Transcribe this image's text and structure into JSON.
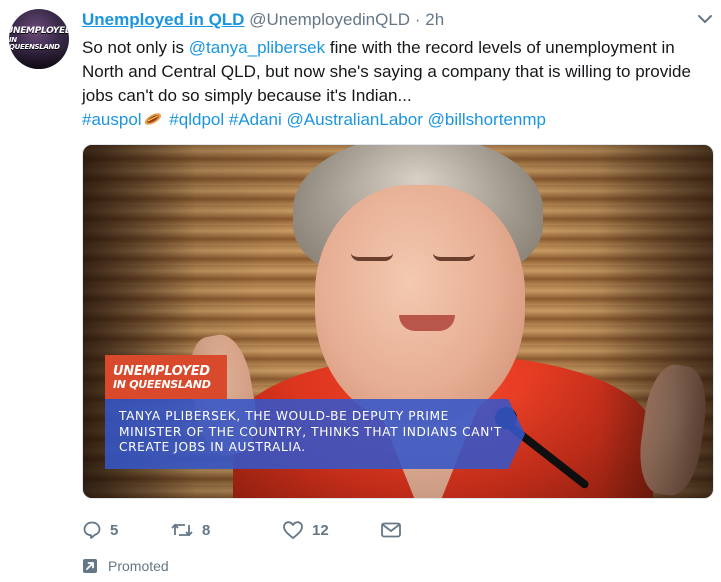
{
  "tweet": {
    "avatar": {
      "line1": "UNEMPLOYED",
      "line2": "IN QUEENSLAND"
    },
    "display_name": "Unemployed in QLD",
    "handle": "@UnemployedinQLD",
    "separator": "·",
    "timestamp": "2h",
    "body": {
      "part1": "So not only is ",
      "mention1": "@tanya_plibersek",
      "part2": " fine with the record levels of unemployment in North and Central QLD, but now she's saying a company that is willing to provide jobs can't do so simply because it's Indian..."
    },
    "hashtags": {
      "h1": "#auspol",
      "h2": "#qldpol",
      "h3": "#Adani",
      "m2": "@AustralianLabor",
      "m3": "@billshortenmp"
    },
    "media": {
      "logo_line1": "UNEMPLOYED",
      "logo_line2": "IN QUEENSLAND",
      "caption": "TANYA PLIBERSEK, THE WOULD-BE DEPUTY PRIME MINISTER OF THE COUNTRY, THINKS THAT INDIANS CAN'T CREATE JOBS IN AUSTRALIA."
    },
    "actions": {
      "reply_count": "5",
      "retweet_count": "8",
      "like_count": "12"
    },
    "promoted_label": "Promoted"
  },
  "colors": {
    "link": "#1b95e0",
    "muted": "#657786",
    "text": "#14171a",
    "logo_bg": "#d94a2c",
    "caption_bg": "#3656c8"
  },
  "icons": [
    "caret-down-icon",
    "reply-icon",
    "retweet-icon",
    "heart-icon",
    "envelope-icon",
    "promoted-arrow-icon",
    "sausage-emoji-icon"
  ]
}
